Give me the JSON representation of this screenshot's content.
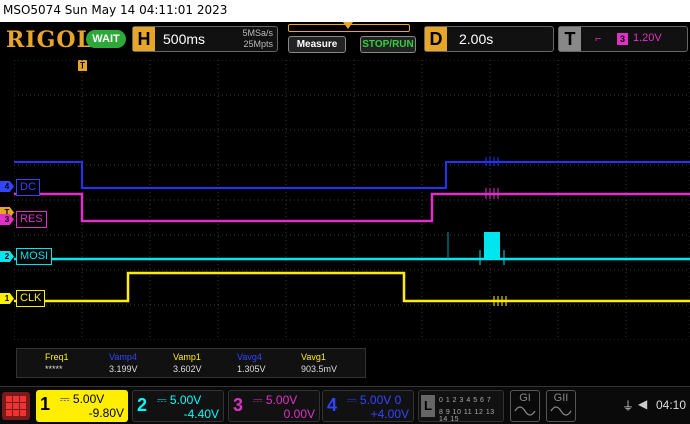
{
  "title_bar": {
    "text": "MSO5074  Sun May 14 04:11:01 2023"
  },
  "toolbar": {
    "logo": "RIGOL",
    "status": "WAIT",
    "horizontal": {
      "letter": "H",
      "timebase": "500ms",
      "sample_rate": "5MSa/s",
      "memory_depth": "25Mpts"
    },
    "measure_button": "Measure",
    "run_stop_button": "STOP/RUN",
    "delay": {
      "letter": "D",
      "value": "2.00s"
    },
    "trigger": {
      "letter": "T",
      "edge_icon": "rising-edge-icon",
      "edge_glyph": "⌐",
      "source": "3",
      "level": "1.20V"
    }
  },
  "trigger_position_marker": "T",
  "channels": [
    {
      "marker": "1",
      "label": "CLK",
      "color": "#ffee00"
    },
    {
      "marker": "2",
      "label": "MOSI",
      "color": "#00e5ee"
    },
    {
      "marker": "3",
      "label": "RES",
      "color": "#e030c8"
    },
    {
      "marker": "4",
      "label": "DC",
      "color": "#2233ff"
    }
  ],
  "measurements": [
    {
      "name": "Freq1",
      "value": "*****",
      "color": "#ffee00"
    },
    {
      "name": "Vamp4",
      "value": "3.199V",
      "color": "#3344ff"
    },
    {
      "name": "Vamp1",
      "value": "3.602V",
      "color": "#ffee00"
    },
    {
      "name": "Vavg4",
      "value": "1.305V",
      "color": "#3344ff"
    },
    {
      "name": "Vavg1",
      "value": "903.5mV",
      "color": "#ffee00"
    }
  ],
  "bottom": {
    "ch1": {
      "num": "1",
      "scale": "5.00V",
      "offset": "-9.80V",
      "scale_icon": "dc-coupling-icon"
    },
    "ch2": {
      "num": "2",
      "scale": "5.00V",
      "offset": "-4.40V"
    },
    "ch3": {
      "num": "3",
      "scale": "5.00V",
      "offset": "0.00V"
    },
    "ch4": {
      "num": "4",
      "scale": "5.00V",
      "offset": "+4.00V",
      "extra": "0"
    },
    "logic": {
      "letter": "L",
      "row1": "0 1 2 3   4 5 6 7",
      "row2": "8 9 10 11 12 13 14 15"
    },
    "gen1": "GI",
    "gen2": "GII",
    "usb_glyph": "⏚",
    "speaker_glyph": "◀",
    "time": "04:10"
  }
}
